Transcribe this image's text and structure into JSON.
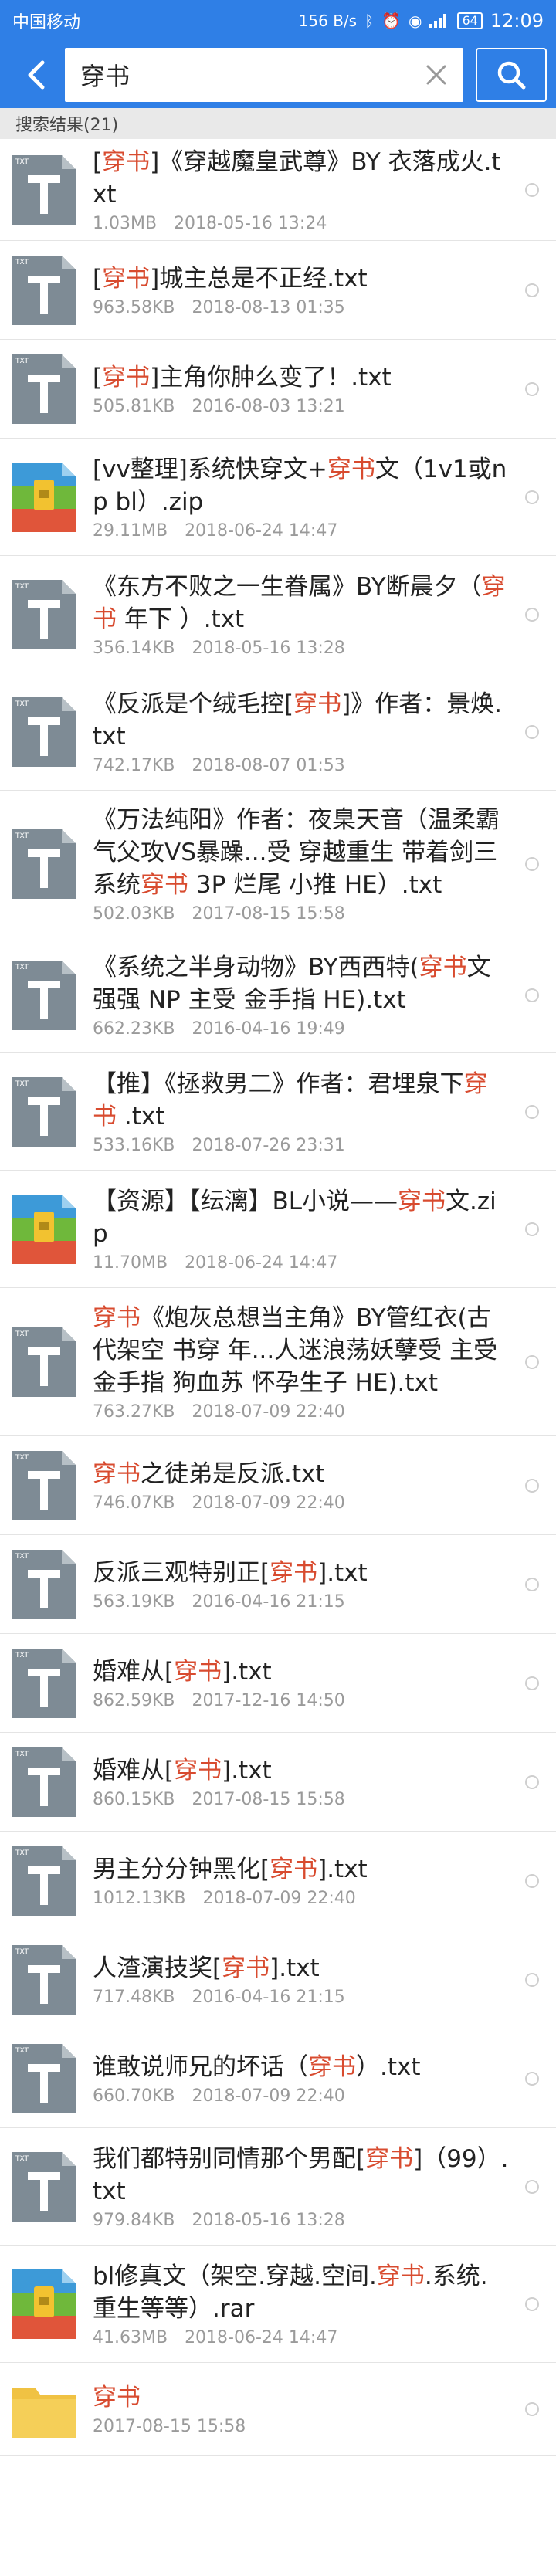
{
  "status_bar": {
    "carrier": "中国移动",
    "network_speed": "156 B/s",
    "battery": "64",
    "time": "12:09"
  },
  "search": {
    "query": "穿书",
    "back_icon": "back-arrow-icon",
    "clear_icon": "clear-icon",
    "search_icon": "search-icon"
  },
  "results_label": "搜索结果(21)",
  "colors": {
    "accent": "#2f7fe6",
    "highlight": "#d84b2f"
  },
  "files": [
    {
      "parts": [
        "[",
        "穿书",
        "]《穿越魔皇武尊》BY 衣落成火.txt"
      ],
      "size": "1.03MB",
      "date": "2018-05-16  13:24",
      "icon": "txt",
      "height": 132
    },
    {
      "parts": [
        "[",
        "穿书",
        "]城主总是不正经.txt"
      ],
      "size": "963.58KB",
      "date": "2018-08-13  01:35",
      "icon": "txt",
      "height": 128
    },
    {
      "parts": [
        "[",
        "穿书",
        "]主角你肿么变了！.txt"
      ],
      "size": "505.81KB",
      "date": "2016-08-03  13:21",
      "icon": "txt",
      "height": 128
    },
    {
      "parts": [
        "[vv整理]系统快穿文+",
        "穿书",
        "文（1v1或np bl）.zip"
      ],
      "size": "29.11MB",
      "date": "2018-06-24  14:47",
      "icon": "zip",
      "height": 152
    },
    {
      "parts": [
        "《东方不败之一生眷属》BY断晨夕（",
        "穿书",
        " 年下 ）.txt"
      ],
      "size": "356.14KB",
      "date": "2018-05-16  13:28",
      "icon": "txt",
      "height": 152
    },
    {
      "parts": [
        "《反派是个绒毛控[",
        "穿书",
        "]》作者：景焕.txt"
      ],
      "size": "742.17KB",
      "date": "2018-08-07  01:53",
      "icon": "txt",
      "height": 152
    },
    {
      "parts": [
        "《万法纯阳》作者：夜臬天音（温柔霸气父攻VS暴躁...受 穿越重生 带着剑三系统",
        "穿书",
        " 3P 烂尾 小推 HE）.txt"
      ],
      "size": "502.03KB",
      "date": "2017-08-15  15:58",
      "icon": "txt",
      "height": 190
    },
    {
      "parts": [
        "《系统之半身动物》BY西西特(",
        "穿书",
        "文 强强 NP 主受 金手指  HE).txt"
      ],
      "size": "662.23KB",
      "date": "2016-04-16  19:49",
      "icon": "txt",
      "height": 150
    },
    {
      "parts": [
        "【推】《拯救男二》作者：君埋泉下",
        "穿书",
        " .txt"
      ],
      "size": "533.16KB",
      "date": "2018-07-26  23:31",
      "icon": "txt",
      "height": 152
    },
    {
      "parts": [
        "【资源】【纭漓】BL小说——",
        "穿书",
        "文.zip"
      ],
      "size": "11.70MB",
      "date": "2018-06-24  14:47",
      "icon": "zip",
      "height": 152
    },
    {
      "parts": [
        "",
        "穿书",
        "《炮灰总想当主角》BY管红衣(古代架空 书穿 年...人迷浪荡妖孽受 主受 金手指 狗血苏 怀孕生子 HE).txt"
      ],
      "size": "763.27KB",
      "date": "2018-07-09  22:40",
      "icon": "txt",
      "height": 192
    },
    {
      "parts": [
        "",
        "穿书",
        "之徒弟是反派.txt"
      ],
      "size": "746.07KB",
      "date": "2018-07-09  22:40",
      "icon": "txt",
      "height": 128
    },
    {
      "parts": [
        "反派三观特别正[",
        "穿书",
        "].txt"
      ],
      "size": "563.19KB",
      "date": "2016-04-16  21:15",
      "icon": "txt",
      "height": 128
    },
    {
      "parts": [
        "婚难从[",
        "穿书",
        "].txt"
      ],
      "size": "862.59KB",
      "date": "2017-12-16  14:50",
      "icon": "txt",
      "height": 128
    },
    {
      "parts": [
        "婚难从[",
        "穿书",
        "].txt"
      ],
      "size": "860.15KB",
      "date": "2017-08-15  15:58",
      "icon": "txt",
      "height": 128
    },
    {
      "parts": [
        "男主分分钟黑化[",
        "穿书",
        "].txt"
      ],
      "size": "1012.13KB",
      "date": "2018-07-09  22:40",
      "icon": "txt",
      "height": 128
    },
    {
      "parts": [
        "人渣演技奖[",
        "穿书",
        "].txt"
      ],
      "size": "717.48KB",
      "date": "2016-04-16  21:15",
      "icon": "txt",
      "height": 128
    },
    {
      "parts": [
        "谁敢说师兄的坏话（",
        "穿书",
        "）.txt"
      ],
      "size": "660.70KB",
      "date": "2018-07-09  22:40",
      "icon": "txt",
      "height": 128
    },
    {
      "parts": [
        "我们都特别同情那个男配[",
        "穿书",
        "]（99）.txt"
      ],
      "size": "979.84KB",
      "date": "2018-05-16  13:28",
      "icon": "txt",
      "height": 152
    },
    {
      "parts": [
        "bl修真文（架空.穿越.空间.",
        "穿书",
        ".系统.重生等等）.rar"
      ],
      "size": "41.63MB",
      "date": "2018-06-24  14:47",
      "icon": "zip",
      "height": 152
    },
    {
      "parts": [
        "",
        "穿书",
        ""
      ],
      "size": "",
      "date": "2017-08-15  15:58",
      "icon": "folder",
      "height": 120
    }
  ]
}
